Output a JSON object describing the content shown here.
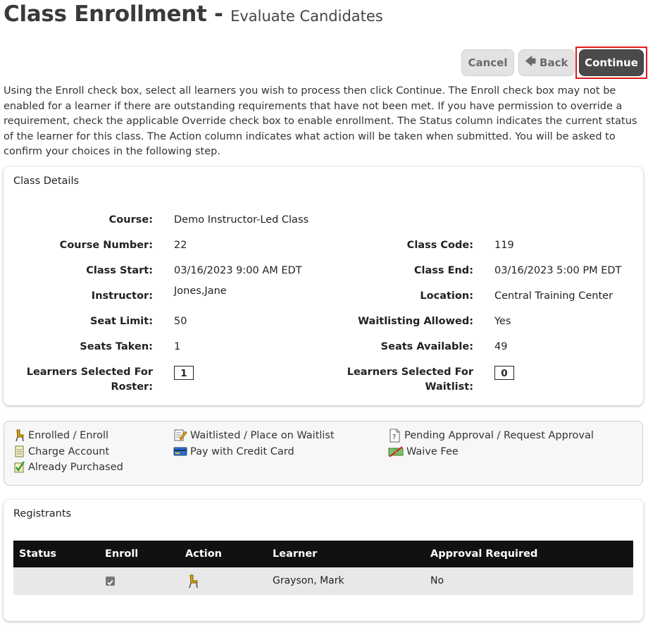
{
  "page": {
    "title": "Class Enrollment -",
    "subtitle": "Evaluate Candidates"
  },
  "toolbar": {
    "cancel_label": "Cancel",
    "back_label": "Back",
    "continue_label": "Continue"
  },
  "instructions": "Using the Enroll check box, select all learners you wish to process then click Continue. The Enroll check box may not be enabled for a learner if there are outstanding requirements that have not been met. If you have permission to override a requirement, check the applicable Override check box to enable enrollment. The Status column indicates the current status of the learner for this class. The Action column indicates what action will be taken when submitted. You will be asked to confirm your choices in the following step.",
  "class_details": {
    "heading": "Class Details",
    "course_label": "Course:",
    "course": "Demo Instructor-Led Class",
    "course_number_label": "Course Number:",
    "course_number": "22",
    "class_code_label": "Class Code:",
    "class_code": "119",
    "class_start_label": "Class Start:",
    "class_start": "03/16/2023 9:00 AM EDT",
    "class_end_label": "Class End:",
    "class_end": "03/16/2023 5:00 PM EDT",
    "instructor_label": "Instructor:",
    "instructor": "Jones,Jane",
    "location_label": "Location:",
    "location": "Central Training Center",
    "seat_limit_label": "Seat Limit:",
    "seat_limit": "50",
    "waitlisting_label": "Waitlisting Allowed:",
    "waitlisting": "Yes",
    "seats_taken_label": "Seats Taken:",
    "seats_taken": "1",
    "seats_available_label": "Seats Available:",
    "seats_available": "49",
    "roster_label_1": "Learners Selected For",
    "roster_label_2": "Roster:",
    "roster_count": "1",
    "waitlist_label_1": "Learners Selected For",
    "waitlist_label_2": "Waitlist:",
    "waitlist_count": "0"
  },
  "legend": {
    "enrolled": "Enrolled / Enroll",
    "waitlisted": "Waitlisted / Place on Waitlist",
    "pending": "Pending Approval / Request Approval",
    "charge": "Charge Account",
    "credit": "Pay with Credit Card",
    "waive": "Waive Fee",
    "purchased": "Already Purchased"
  },
  "registrants": {
    "heading": "Registrants",
    "columns": [
      "Status",
      "Enroll",
      "Action",
      "Learner",
      "Approval Required"
    ],
    "rows": [
      {
        "status": "",
        "enroll_checked": true,
        "action_icon": "enroll-chair-icon",
        "learner": "Grayson, Mark",
        "approval": "No"
      }
    ]
  },
  "colors": {
    "continue_bg": "#4a4a4a",
    "highlight_outline": "#e01b1b",
    "table_header_bg": "#111111",
    "row_bg": "#e8e8e8"
  }
}
